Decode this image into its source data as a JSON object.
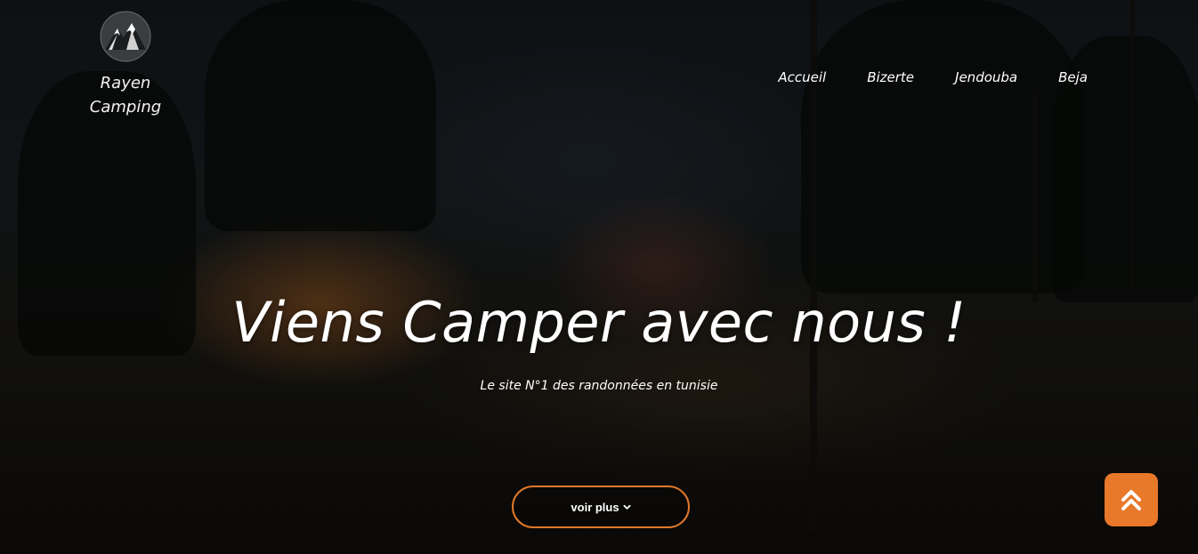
{
  "brand": {
    "name_line1": "Rayen",
    "name_line2": "Camping",
    "logo_icon": "mountain-logo-icon"
  },
  "nav": {
    "items": [
      {
        "label": "Accueil"
      },
      {
        "label": "Bizerte"
      },
      {
        "label": "Jendouba"
      },
      {
        "label": "Beja"
      }
    ]
  },
  "hero": {
    "title": "Viens Camper avec nous !",
    "subtitle": "Le site N°1 des randonnées en tunisie",
    "cta_label": "voir plus",
    "cta_icon": "chevron-down-icon"
  },
  "scroll_top": {
    "icon": "double-chevron-up-icon"
  },
  "colors": {
    "accent": "#e8782a",
    "text": "#ffffff"
  }
}
